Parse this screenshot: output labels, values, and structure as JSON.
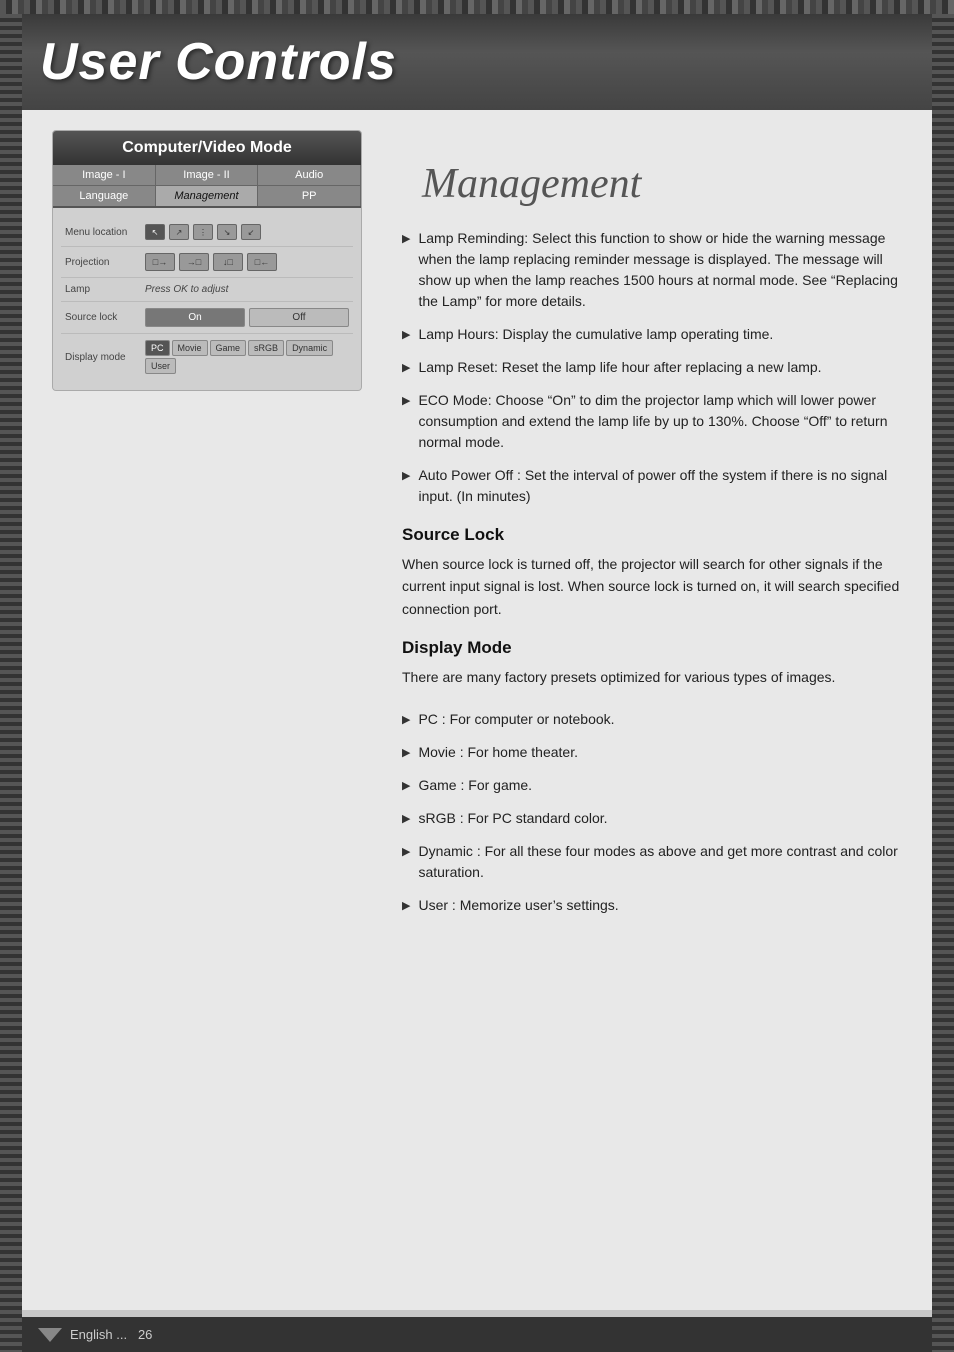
{
  "header": {
    "title": "User Controls"
  },
  "cv_mode": {
    "title": "Computer/Video Mode",
    "tabs_row1": [
      {
        "label": "Image - I",
        "active": false
      },
      {
        "label": "Image - II",
        "active": false
      },
      {
        "label": "Audio",
        "active": false
      }
    ],
    "tabs_row2": [
      {
        "label": "Language",
        "active": false
      },
      {
        "label": "Management",
        "active": true
      },
      {
        "label": "PP",
        "active": false
      }
    ],
    "menu_items": [
      {
        "label": "Menu location"
      },
      {
        "label": "Projection"
      },
      {
        "label": "Lamp"
      },
      {
        "label": "Source lock"
      },
      {
        "label": "Display mode"
      }
    ],
    "lamp_text": "Press OK to adjust",
    "source_lock": {
      "on": "On",
      "off": "Off"
    },
    "display_modes": [
      "PC",
      "Movie",
      "Game",
      "sRGB",
      "Dynamic",
      "User"
    ]
  },
  "management_heading": "Management",
  "bullet_items": [
    {
      "text": "Lamp Reminding: Select this function to show or hide the warning message when the lamp replacing reminder message is displayed. The message will show up when the lamp reaches 1500 hours at normal mode. See “Replacing the Lamp” for more details."
    },
    {
      "text": "Lamp Hours: Display the cumulative lamp operating time."
    },
    {
      "text": "Lamp Reset: Reset the lamp life hour after replacing a new lamp."
    },
    {
      "text": "ECO Mode: Choose “On” to dim the projector lamp which will lower power consumption and extend the lamp life by up to 130%. Choose “Off” to return normal mode."
    },
    {
      "text": "Auto Power Off : Set the interval of power off the system if there is no signal input. (In minutes)"
    }
  ],
  "source_lock_section": {
    "heading": "Source Lock",
    "text": "When source lock is turned off, the projector will search for other signals if the current input signal is lost. When source lock is turned on, it will search specified connection port."
  },
  "display_mode_section": {
    "heading": "Display Mode",
    "text": "There are many factory presets optimized for various types of images."
  },
  "display_mode_bullets": [
    {
      "text": "PC : For computer or notebook."
    },
    {
      "text": "Movie : For home theater."
    },
    {
      "text": "Game : For game."
    },
    {
      "text": "sRGB : For PC standard color."
    },
    {
      "text": "Dynamic : For all these four modes as above and get more contrast and color saturation."
    },
    {
      "text": "User : Memorize user’s settings."
    }
  ],
  "footer": {
    "language": "English ...",
    "page": "26"
  }
}
